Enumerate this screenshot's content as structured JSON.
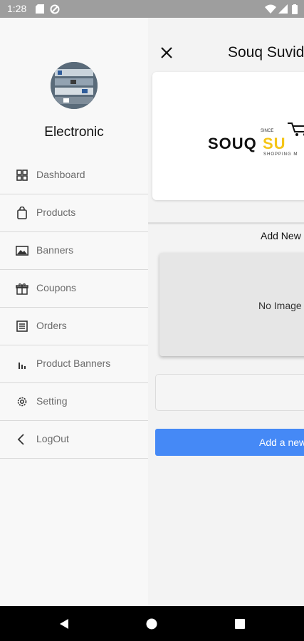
{
  "status_bar": {
    "time": "1:28",
    "icons": [
      "sd-card-icon",
      "data-saver-icon",
      "wifi-icon",
      "signal-icon",
      "battery-icon"
    ]
  },
  "drawer": {
    "avatar_alt": "store-avatar",
    "store_name": "Electronic",
    "items": [
      {
        "label": "Dashboard",
        "icon": "dashboard-icon"
      },
      {
        "label": "Products",
        "icon": "shopping-bag-icon"
      },
      {
        "label": "Banners",
        "icon": "image-icon"
      },
      {
        "label": "Coupons",
        "icon": "gift-icon"
      },
      {
        "label": "Orders",
        "icon": "orders-icon"
      },
      {
        "label": "Product Banners",
        "icon": "bar-chart-icon"
      },
      {
        "label": "Setting",
        "icon": "gear-icon"
      },
      {
        "label": "LogOut",
        "icon": "chevron-left-icon"
      }
    ]
  },
  "main": {
    "title": "Souq Suvid",
    "logo": {
      "since": "SINCE",
      "brand_dark": "SOUQ",
      "brand_yellow": "SU",
      "tagline": "SHOPPING M"
    },
    "section_title": "Add New",
    "image_placeholder": "No Image S",
    "add_button_label": "Add a new"
  },
  "colors": {
    "status_bar": "#9e9e9e",
    "accent_button": "#4589f6",
    "brand_yellow": "#f5c518",
    "drawer_bg": "#f8f8f8"
  }
}
